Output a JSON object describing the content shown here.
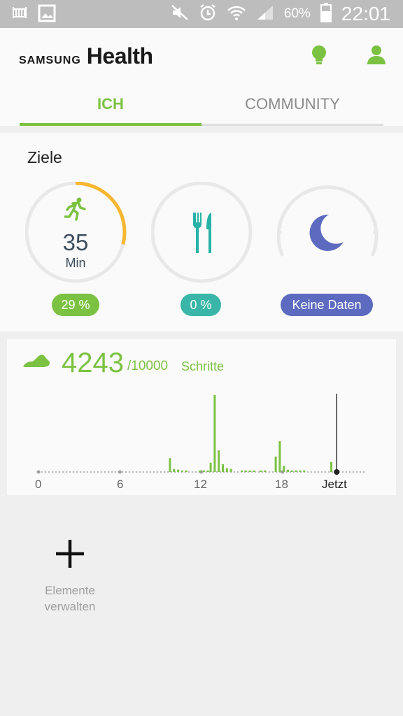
{
  "status_bar": {
    "battery_text": "60%",
    "time": "22:01",
    "icons": [
      "crib-icon",
      "image-icon",
      "mute-icon",
      "alarm-icon",
      "wifi-icon",
      "signal-icon",
      "battery-icon"
    ]
  },
  "header": {
    "brand_samsung": "SAMSUNG",
    "brand_health": "Health",
    "icons": [
      "lightbulb-icon",
      "profile-icon"
    ],
    "accent_color": "#7cc242"
  },
  "tabs": [
    {
      "label": "ICH",
      "selected": true
    },
    {
      "label": "COMMUNITY",
      "selected": false
    }
  ],
  "goals": {
    "title": "Ziele",
    "activity": {
      "value": "35",
      "unit": "Min",
      "percent_label": "29 %",
      "progress": 0.29,
      "color": "#f7b731",
      "icon": "running-icon"
    },
    "food": {
      "percent_label": "0 %",
      "progress": 0,
      "color": "#26b3a6",
      "icon": "fork-knife-icon"
    },
    "sleep": {
      "label": "Keine Daten",
      "color": "#5c6bc0",
      "icon": "moon-icon"
    },
    "pill_colors": {
      "activity": "#7cc242",
      "food": "#39b6a8",
      "sleep": "#5c6bc0"
    }
  },
  "steps": {
    "count": "4243",
    "target": "/10000",
    "unit": "Schritte",
    "icon": "shoe-icon",
    "axis_labels": [
      "0",
      "6",
      "12",
      "18",
      "Jetzt"
    ]
  },
  "chart_data": {
    "type": "bar",
    "title": "",
    "xlabel": "",
    "ylabel": "",
    "x_ticks": [
      "0",
      "6",
      "12",
      "18",
      "Jetzt"
    ],
    "now_hour": 22.0,
    "series": [
      {
        "bars": [
          {
            "h": 9.7,
            "v": 18
          },
          {
            "h": 10.0,
            "v": 4
          },
          {
            "h": 10.3,
            "v": 3
          },
          {
            "h": 10.6,
            "v": 2
          },
          {
            "h": 10.9,
            "v": 2
          },
          {
            "h": 11.9,
            "v": 2
          },
          {
            "h": 12.2,
            "v": 2
          },
          {
            "h": 12.5,
            "v": 2
          },
          {
            "h": 12.7,
            "v": 12
          },
          {
            "h": 13.0,
            "v": 100
          },
          {
            "h": 13.3,
            "v": 28
          },
          {
            "h": 13.6,
            "v": 10
          },
          {
            "h": 13.9,
            "v": 5
          },
          {
            "h": 14.2,
            "v": 4
          },
          {
            "h": 15.0,
            "v": 2
          },
          {
            "h": 15.3,
            "v": 2
          },
          {
            "h": 15.6,
            "v": 2
          },
          {
            "h": 15.9,
            "v": 2
          },
          {
            "h": 16.4,
            "v": 2
          },
          {
            "h": 16.7,
            "v": 2
          },
          {
            "h": 17.5,
            "v": 20
          },
          {
            "h": 17.8,
            "v": 40
          },
          {
            "h": 18.1,
            "v": 8
          },
          {
            "h": 18.4,
            "v": 3
          },
          {
            "h": 18.7,
            "v": 2
          },
          {
            "h": 19.0,
            "v": 2
          },
          {
            "h": 19.3,
            "v": 2
          },
          {
            "h": 19.6,
            "v": 2
          },
          {
            "h": 21.6,
            "v": 13
          }
        ]
      }
    ],
    "bar_color": "#7cc242",
    "ylim": [
      0,
      100
    ]
  },
  "manage": {
    "line1": "Elemente",
    "line2": "verwalten",
    "icon": "plus-icon"
  }
}
